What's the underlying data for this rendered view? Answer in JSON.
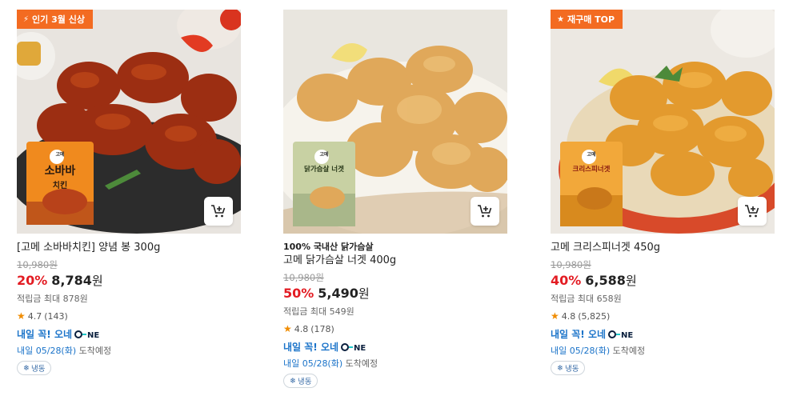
{
  "products": [
    {
      "badge": "인기 3월 신상",
      "badge_icon": "lightning-icon",
      "tagline": "",
      "name": "[고메 소바바치킨] 양념 봉 300g",
      "original_price": "10,980원",
      "discount": "20%",
      "price": "8,784",
      "currency": "원",
      "points": "적립금 최대 878원",
      "rating": "4.7",
      "reviews": "(143)",
      "delivery": "내일 꼭! 오네",
      "arrival_date": "내일 05/28(화)",
      "arrival_suffix": "도착예정",
      "storage": "냉동",
      "package_brand": "고메",
      "package_title": "소바바",
      "package_sub": "치킨"
    },
    {
      "badge": "",
      "tagline": "100% 국내산 닭가슴살",
      "name": "고메 닭가슴살 너겟 400g",
      "original_price": "10,980원",
      "discount": "50%",
      "price": "5,490",
      "currency": "원",
      "points": "적립금 최대 549원",
      "rating": "4.8",
      "reviews": "(178)",
      "delivery": "내일 꼭! 오네",
      "arrival_date": "내일 05/28(화)",
      "arrival_suffix": "도착예정",
      "storage": "냉동",
      "package_brand": "고메",
      "package_title": "닭가슴살 너겟"
    },
    {
      "badge": "재구매 TOP",
      "badge_icon": "star-icon",
      "tagline": "",
      "name": "고메 크리스피너겟 450g",
      "original_price": "10,980원",
      "discount": "40%",
      "price": "6,588",
      "currency": "원",
      "points": "적립금 최대 658원",
      "rating": "4.8",
      "reviews": "(5,825)",
      "delivery": "내일 꼭! 오네",
      "arrival_date": "내일 05/28(화)",
      "arrival_suffix": "도착예정",
      "storage": "냉동",
      "package_brand": "고메",
      "package_title": "크리스피너겟"
    }
  ],
  "colors": {
    "badge": "#f36b21",
    "discount": "#e31c23",
    "delivery": "#1a73c9",
    "star": "#f08c00"
  }
}
